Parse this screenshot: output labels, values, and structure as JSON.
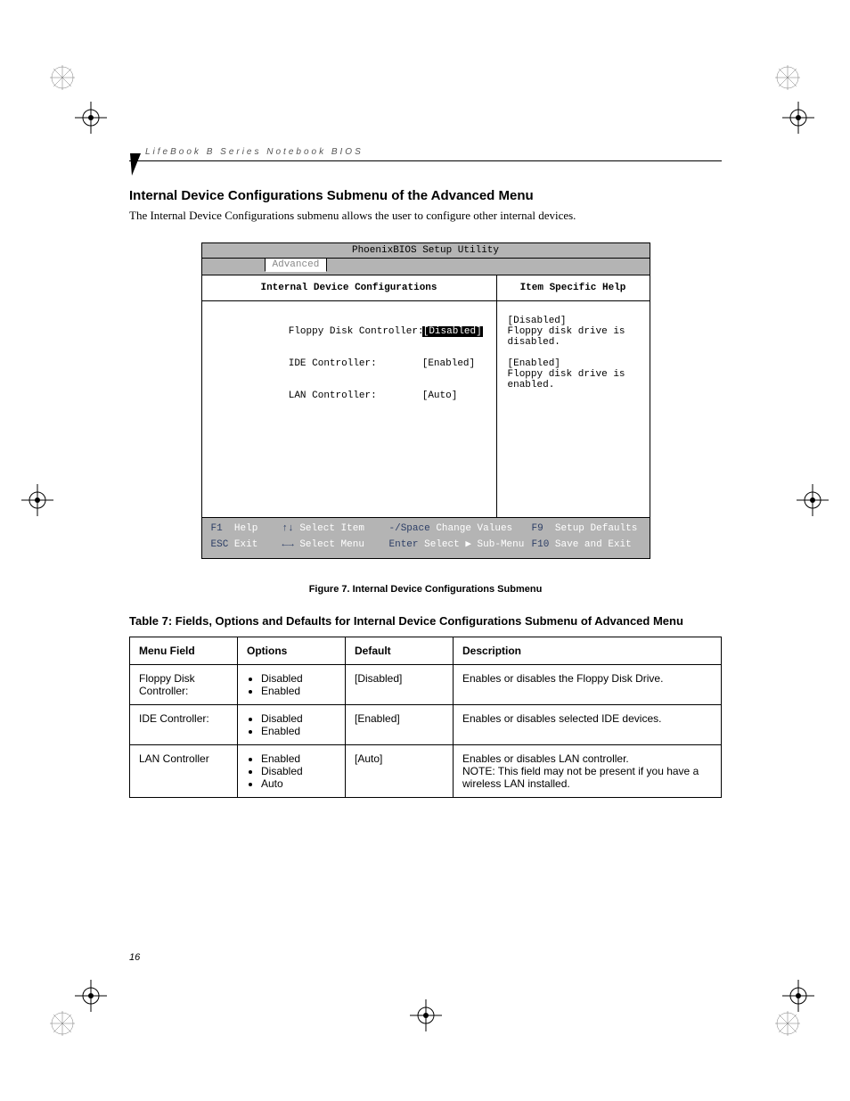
{
  "running_head": "LifeBook B Series Notebook BIOS",
  "section_title": "Internal Device Configurations Submenu of the Advanced Menu",
  "intro": "The Internal Device Configurations submenu allows the user to configure other internal devices.",
  "bios": {
    "title": "PhoenixBIOS Setup Utility",
    "active_tab": "Advanced",
    "left_heading": "Internal Device Configurations",
    "right_heading": "Item Specific Help",
    "options": [
      {
        "label": "Floppy Disk Controller:",
        "value": "[Disabled]",
        "selected": true
      },
      {
        "label": "IDE Controller:",
        "value": "[Enabled]",
        "selected": false
      },
      {
        "label": "LAN Controller:",
        "value": "[Auto]",
        "selected": false
      }
    ],
    "help": {
      "l1": "[Disabled]",
      "l2": "Floppy disk drive is",
      "l3": "disabled.",
      "l4": "[Enabled]",
      "l5": "Floppy disk drive is",
      "l6": "enabled."
    },
    "footer": {
      "f1": "F1",
      "help": "Help",
      "ud": "↑↓",
      "select_item": "Select Item",
      "pm": "-/Space",
      "change_values": "Change Values",
      "f9": "F9",
      "setup_defaults": "Setup Defaults",
      "esc": "ESC",
      "exit": "Exit",
      "lr": "←→",
      "select_menu": "Select Menu",
      "enter": "Enter",
      "select_sub": "Select ▶ Sub-Menu",
      "f10": "F10",
      "save_exit": "Save and Exit"
    }
  },
  "figure_caption": "Figure 7.  Internal Device Configurations Submenu",
  "table_caption": "Table 7: Fields, Options and Defaults for Internal Device Configurations Submenu of Advanced Menu",
  "table": {
    "headers": {
      "menu": "Menu Field",
      "options": "Options",
      "default": "Default",
      "desc": "Description"
    },
    "rows": [
      {
        "menu": "Floppy Disk Controller:",
        "options": [
          "Disabled",
          "Enabled"
        ],
        "default": "[Disabled]",
        "desc": "Enables or disables the Floppy Disk Drive."
      },
      {
        "menu": "IDE Controller:",
        "options": [
          "Disabled",
          "Enabled"
        ],
        "default": "[Enabled]",
        "desc": "Enables or disables selected IDE devices."
      },
      {
        "menu": "LAN Controller",
        "options": [
          "Enabled",
          "Disabled",
          "Auto"
        ],
        "default": "[Auto]",
        "desc": "Enables or disables LAN controller.\nNOTE: This field may not be present if you have a wireless LAN installed."
      }
    ]
  },
  "page_number": "16"
}
